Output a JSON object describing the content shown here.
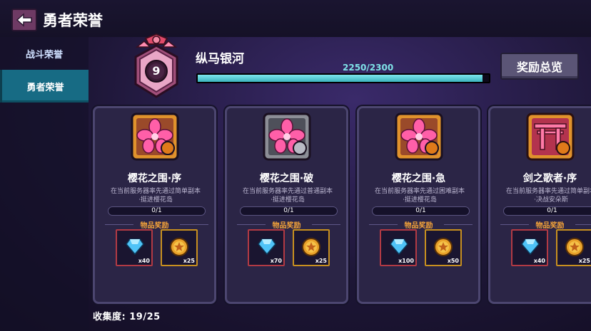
{
  "header": {
    "title": "勇者荣誉"
  },
  "sidebar": {
    "items": [
      {
        "label": "战斗荣誉"
      },
      {
        "label": "勇者荣誉"
      }
    ]
  },
  "rank": {
    "level": "9",
    "title": "纵马银河",
    "progress_text": "2250/2300",
    "progress_fraction": 0.978
  },
  "overview_button": {
    "label": "奖励总览"
  },
  "cards": [
    {
      "name": "樱花之围·序",
      "desc_line1": "在当前服务器率先通过简单副本",
      "desc_line2": "·挺进樱花岛",
      "count": "0/1",
      "reward_label": "物品奖励",
      "gem_qty": "x40",
      "coin_qty": "x25",
      "icon": "sakura-gold-medal-icon"
    },
    {
      "name": "樱花之围·破",
      "desc_line1": "在当前服务器率先通过普通副本",
      "desc_line2": "·挺进樱花岛",
      "count": "0/1",
      "reward_label": "物品奖励",
      "gem_qty": "x70",
      "coin_qty": "x25",
      "icon": "sakura-silver-medal-icon"
    },
    {
      "name": "樱花之围·急",
      "desc_line1": "在当前服务器率先通过困难副本",
      "desc_line2": "·挺进樱花岛",
      "count": "0/1",
      "reward_label": "物品奖励",
      "gem_qty": "x100",
      "coin_qty": "x50",
      "icon": "sakura-gold-medal-icon"
    },
    {
      "name": "剑之歌者·序",
      "desc_line1": "在当前服务器率先通过简单副本",
      "desc_line2": "·决战安朵斯",
      "count": "0/1",
      "reward_label": "物品奖励",
      "gem_qty": "x40",
      "coin_qty": "x25",
      "icon": "torii-medal-icon"
    }
  ],
  "collection": {
    "text": "收集度: 19/25"
  },
  "colors": {
    "accent_cyan": "#7de7ee",
    "active_tab": "#176b84",
    "reward_orange": "#f2a23a"
  }
}
